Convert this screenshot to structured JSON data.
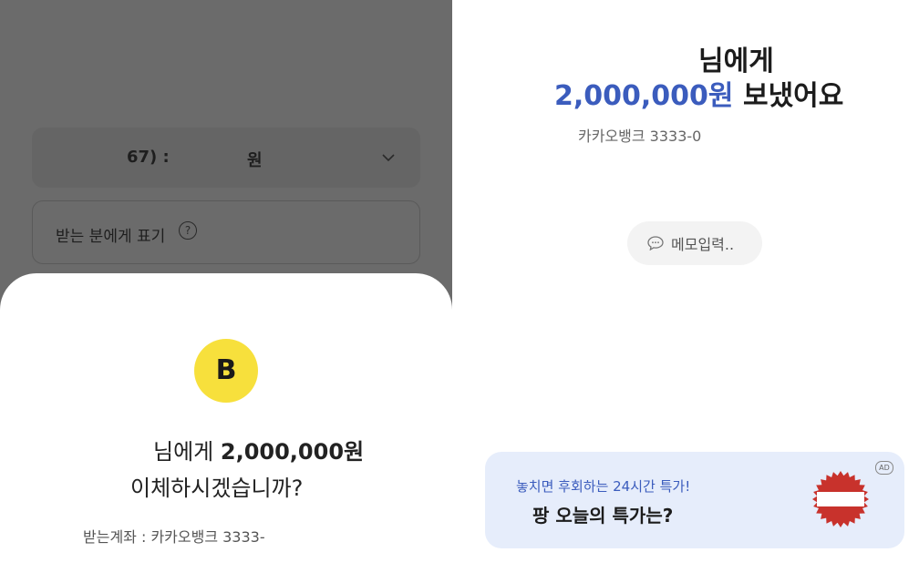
{
  "left": {
    "amount_select": {
      "prefix": "67) :",
      "unit": "원"
    },
    "display_name": {
      "label": "받는 분에게 표기",
      "help": "?"
    },
    "confirm": {
      "logo_letter": "B",
      "line1_prefix": "님에게",
      "line1_amount": "2,000,000원",
      "line2": "이체하시겠습니까?",
      "account": "받는계좌 : 카카오뱅크 3333-"
    }
  },
  "right": {
    "sent": {
      "line1": "님에게",
      "amount": "2,000,000원",
      "verb": "보냈어요",
      "account": "카카오뱅크 3333-0"
    },
    "memo": {
      "label": "메모입력..",
      "icon": "speech-bubble-icon"
    },
    "ad": {
      "badge": "AD",
      "subtitle": "놓치면 후회하는 24시간 특가!",
      "title": "팡 오늘의 특가는?"
    }
  },
  "colors": {
    "dim_overlay": "#6b6b6b",
    "logo_yellow": "#f7e03c",
    "accent_blue": "#3b5cbd",
    "ad_background": "#e6edfb"
  }
}
